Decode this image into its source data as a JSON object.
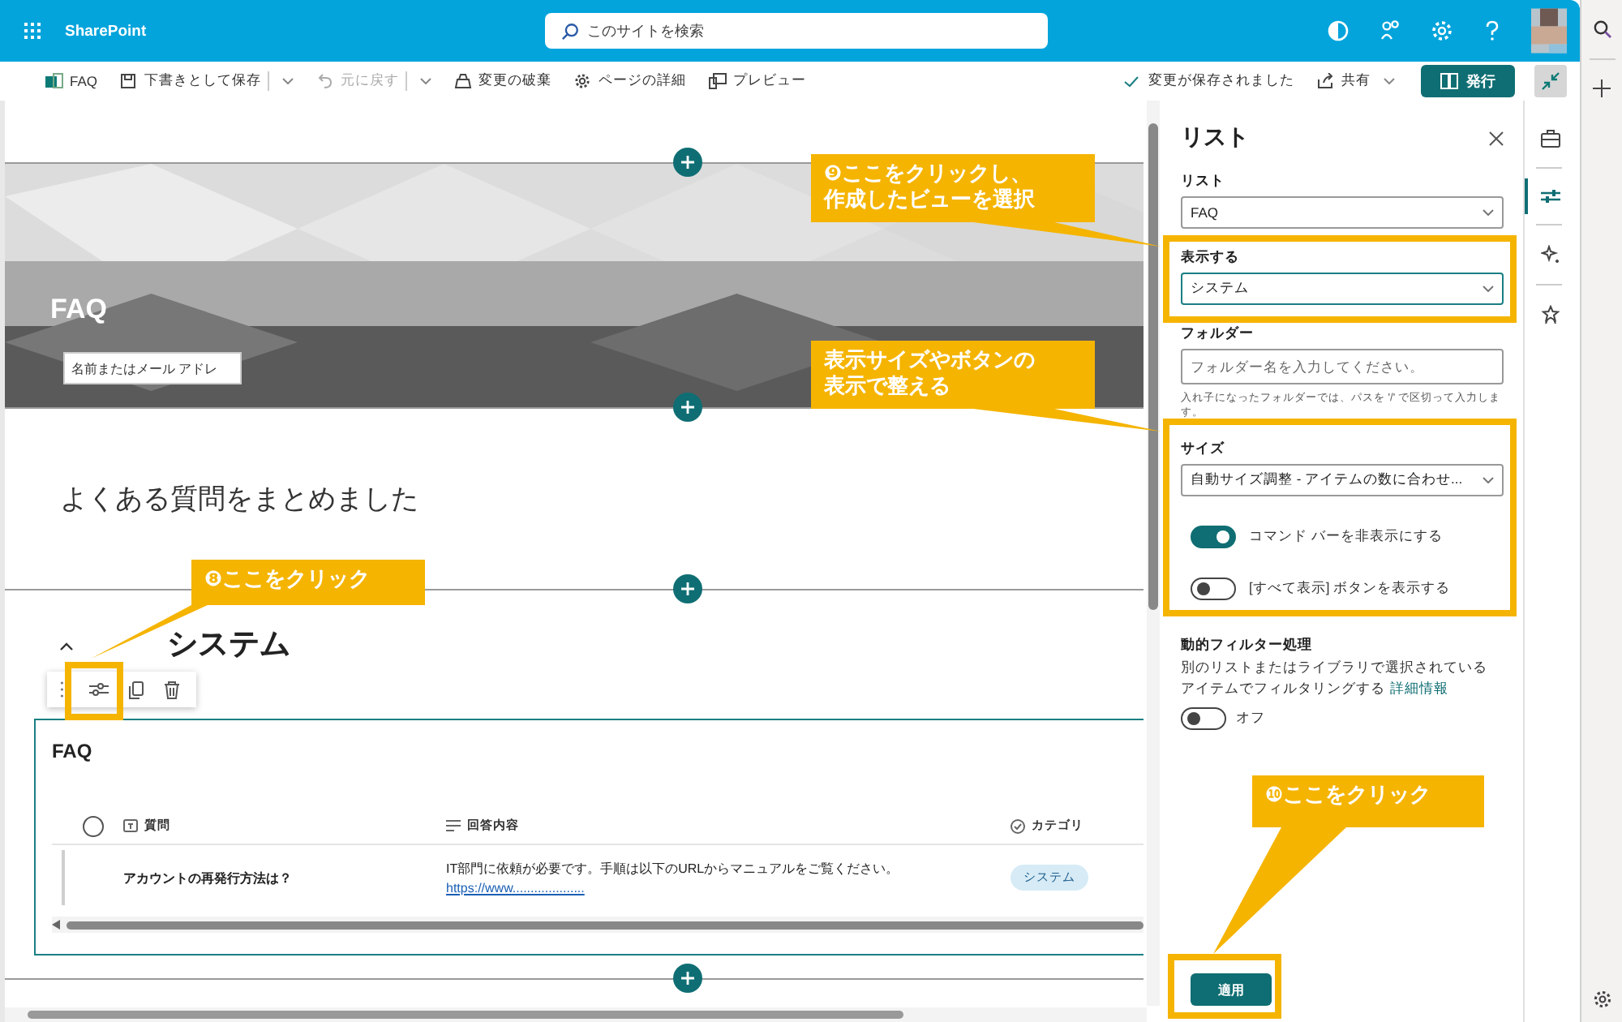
{
  "top_bar": {
    "app_name": "SharePoint",
    "search": {
      "placeholder": "このサイトを検索"
    }
  },
  "toolbar": {
    "items": [
      {
        "label": "FAQ",
        "kind": "page",
        "disabled": false
      },
      {
        "label": "下書きとして保存",
        "kind": "save",
        "disabled": false
      },
      {
        "label": "元に戻す",
        "kind": "undo",
        "disabled": true
      },
      {
        "label": "変更の破棄",
        "kind": "discard",
        "disabled": false
      },
      {
        "label": "ページの詳細",
        "kind": "details",
        "disabled": false
      },
      {
        "label": "プレビュー",
        "kind": "preview",
        "disabled": false
      }
    ],
    "status": "変更が保存されました",
    "share": "共有",
    "publish": "発行"
  },
  "canvas": {
    "hero": {
      "title": "FAQ",
      "author_field": {
        "placeholder": "名前またはメール アドレ"
      }
    },
    "text": "よくある質問をまとめました",
    "section_heading": "システム",
    "list": {
      "title": "FAQ",
      "select_all_checked": false,
      "columns": [
        {
          "label": "質問",
          "kind": "text"
        },
        {
          "label": "回答内容",
          "kind": "multiline"
        },
        {
          "label": "カテゴリ",
          "kind": "choice"
        }
      ],
      "rows": [
        {
          "question": "アカウントの再発行方法は？",
          "answer": "IT部門に依頼が必要です。手順は以下のURLからマニュアルをご覧ください。",
          "link": "https://www....................",
          "category": "システム"
        }
      ]
    }
  },
  "panel": {
    "title": "リスト",
    "fields": [
      {
        "label": "リスト",
        "value": "FAQ",
        "focused": false
      },
      {
        "label": "表示する",
        "value": "システム",
        "focused": true
      }
    ],
    "folder": {
      "label": "フォルダー",
      "placeholder": "フォルダー名を入力してください。",
      "hint": "入れ子になったフォルダーでは、パスを '/' で区切って入力します。"
    },
    "size": {
      "label": "サイズ",
      "value": "自動サイズ調整 - アイテムの数に合わせ..."
    },
    "toggles": [
      {
        "label": "コマンド バーを非表示にする",
        "on": true
      },
      {
        "label": "[すべて表示] ボタンを表示する",
        "on": false
      }
    ],
    "dynamic_filter": {
      "heading": "動的フィルター処理",
      "description": "別のリストまたはライブラリで選択されているアイテムでフィルタリングする",
      "link": "詳細情報",
      "on": false,
      "state_label": "オフ"
    },
    "apply": "適用",
    "rail": [
      {
        "kind": "toolbox",
        "selected": false
      },
      {
        "kind": "properties",
        "selected": true
      },
      {
        "kind": "design",
        "selected": false
      },
      {
        "kind": "award",
        "selected": false
      }
    ]
  },
  "annotations": [
    {
      "lines": [
        "❾ここをクリックし、",
        "作成したビューを選択"
      ]
    },
    {
      "lines": [
        "表示サイズやボタンの",
        "表示で整える"
      ]
    },
    {
      "lines": [
        "❽ここをクリック"
      ]
    },
    {
      "lines": [
        "❿ここをクリック"
      ]
    }
  ]
}
